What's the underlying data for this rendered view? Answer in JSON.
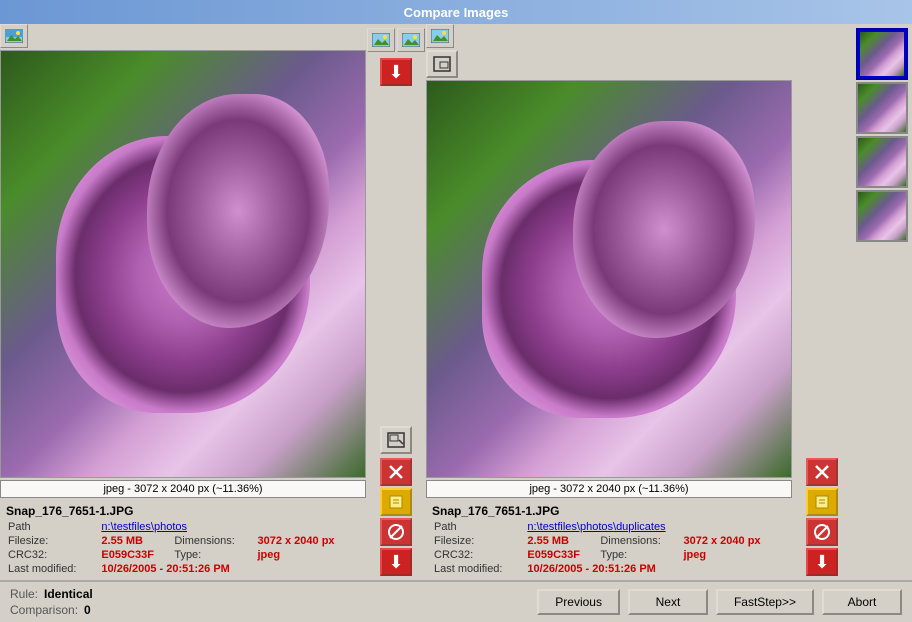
{
  "window": {
    "title": "Compare Images"
  },
  "left": {
    "filename": "Snap_176_7651-1.JPG",
    "path_label": "Path",
    "path_value": "n:\\testfiles\\photos",
    "filesize_label": "Filesize:",
    "filesize_value": "2.55 MB",
    "dimensions_label": "Dimensions:",
    "dimensions_value": "3072 x 2040 px",
    "crc_label": "CRC32:",
    "crc_value": "E059C33F",
    "type_label": "Type:",
    "type_value": "jpeg",
    "modified_label": "Last modified:",
    "modified_value": "10/26/2005 - 20:51:26 PM",
    "image_info": "jpeg - 3072 x 2040 px (~11.36%)"
  },
  "right": {
    "filename": "Snap_176_7651-1.JPG",
    "path_label": "Path",
    "path_value": "n:\\testfiles\\photos\\duplicates",
    "filesize_label": "Filesize:",
    "filesize_value": "2.55 MB",
    "dimensions_label": "Dimensions:",
    "dimensions_value": "3072 x 2040 px",
    "crc_label": "CRC32:",
    "crc_value": "E059C33F",
    "type_label": "Type:",
    "type_value": "jpeg",
    "modified_label": "Last modified:",
    "modified_value": "10/26/2005 - 20:51:26 PM",
    "image_info": "jpeg - 3072 x 2040 px (~11.36%)"
  },
  "bottom": {
    "rule_label": "Rule:",
    "rule_value": "Identical",
    "comparison_label": "Comparison:",
    "comparison_value": "0",
    "previous_btn": "Previous",
    "next_btn": "Next",
    "faststep_btn": "FastStep>>",
    "abort_btn": "Abort"
  }
}
